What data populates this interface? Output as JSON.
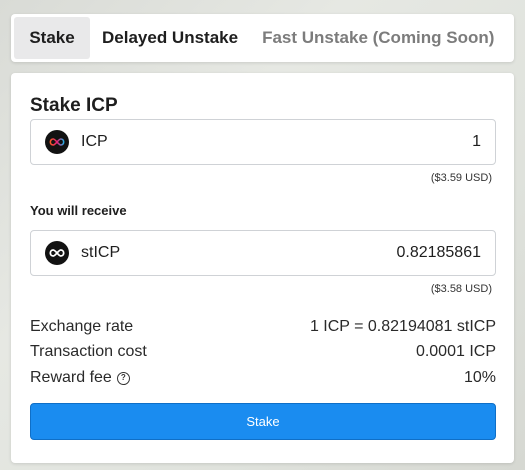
{
  "tabs": [
    {
      "label": "Stake",
      "state": "active"
    },
    {
      "label": "Delayed Unstake",
      "state": "normal"
    },
    {
      "label": "Fast Unstake (Coming Soon)",
      "state": "disabled"
    }
  ],
  "card": {
    "title": "Stake ICP",
    "input": {
      "token": "ICP",
      "icon": "icp-infinity-icon",
      "value": "1",
      "usd": "($3.59 USD)"
    },
    "receive_label": "You will receive",
    "output": {
      "token": "stICP",
      "icon": "sticp-infinity-icon",
      "value": "0.82185861",
      "usd": "($3.58 USD)"
    },
    "info": {
      "exchange_rate_label": "Exchange rate",
      "exchange_rate_value": "1 ICP = 0.82194081 stICP",
      "transaction_cost_label": "Transaction cost",
      "transaction_cost_value": "0.0001 ICP",
      "reward_fee_label": "Reward fee",
      "reward_fee_help": "?",
      "reward_fee_value": "10%"
    },
    "stake_button": "Stake"
  },
  "colors": {
    "accent": "#1a8cf0",
    "tab_active_bg": "#e9e9ea",
    "disabled_text": "#7c7c7c"
  }
}
